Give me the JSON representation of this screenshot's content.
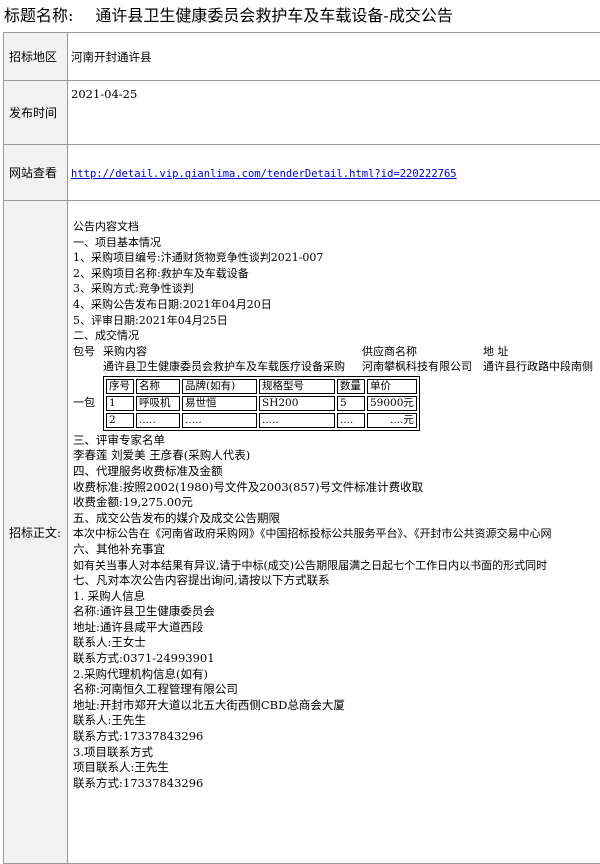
{
  "title": {
    "label": "标题名称:",
    "text": "通许县卫生健康委员会救护车及车载设备-成交公告"
  },
  "fields": {
    "area_label": "招标地区",
    "area_value": "河南开封通许县",
    "date_label": "发布时间",
    "date_value": "2021-04-25",
    "link_label": "网站查看",
    "link_value": "http://detail.vip.qianlima.com/tenderDetail.html?id=220222765",
    "body_label": "招标正文:"
  },
  "body": {
    "doc_heading": "公告内容文档",
    "s1": "一、项目基本情况",
    "s1_items": [
      "1、采购项目编号:汴通财货物竞争性谈判2021-007",
      "2、采购项目名称:救护车及车载设备",
      "3、采购方式:竞争性谈判",
      "4、采购公告发布日期:2021年04月20日",
      "5、评审日期:2021年04月25日"
    ],
    "s2": "二、成交情况",
    "result_header": {
      "pkg": "包号",
      "content": "采购内容",
      "supplier": "供应商名称",
      "address": "地 址"
    },
    "result_row": {
      "content": "通许县卫生健康委员会救护车及车载医疗设备采购",
      "supplier": "河南攀枫科技有限公司",
      "address": "通许县行政路中段南侧",
      "pkg": "一包"
    },
    "sub_table": {
      "headers": [
        "序号",
        "名称",
        "品牌(如有)",
        "规格型号",
        "数量",
        "单价"
      ],
      "rows": [
        [
          "1",
          "呼吸机",
          "易世恒",
          "SH200",
          "5",
          "59000元"
        ],
        [
          "2",
          ".....",
          ".....",
          ".....",
          "....",
          "....元"
        ]
      ]
    },
    "s3": "三、评审专家名单",
    "experts": "李春莲 刘爱美 王彦春(采购人代表)",
    "s4": "四、代理服务收费标准及金额",
    "fee_standard": "收费标准:按照2002(1980)号文件及2003(857)号文件标准计费收取",
    "fee_amount": "收费金额:19,275.00元",
    "s5": "五、成交公告发布的媒介及成交公告期限",
    "media": "本次中标公告在《河南省政府采购网》《中国招标投标公共服务平台》、《开封市公共资源交易中心网",
    "s6": "六、其他补充事宜",
    "supplement": "如有关当事人对本结果有异议,请于中标(成交)公告期限届满之日起七个工作日内以书面的形式同时",
    "s7": "七、凡对本次公告内容提出询问,请按以下方式联系",
    "c1_title": "1. 采购人信息",
    "c1_name": "名称:通许县卫生健康委员会",
    "c1_addr": "地址:通许县咸平大道西段",
    "c1_contact": "联系人:王女士",
    "c1_phone": "联系方式:0371-24993901",
    "c2_title": "2.采购代理机构信息(如有)",
    "c2_name": "名称:河南恒久工程管理有限公司",
    "c2_addr": "地址:开封市郑开大道以北五大街西侧CBD总商会大厦",
    "c2_contact": "联系人:王先生",
    "c2_phone": "联系方式:17337843296",
    "c3_title": "3.项目联系方式",
    "c3_contact": "项目联系人:王先生",
    "c3_phone": "联系方式:17337843296"
  }
}
